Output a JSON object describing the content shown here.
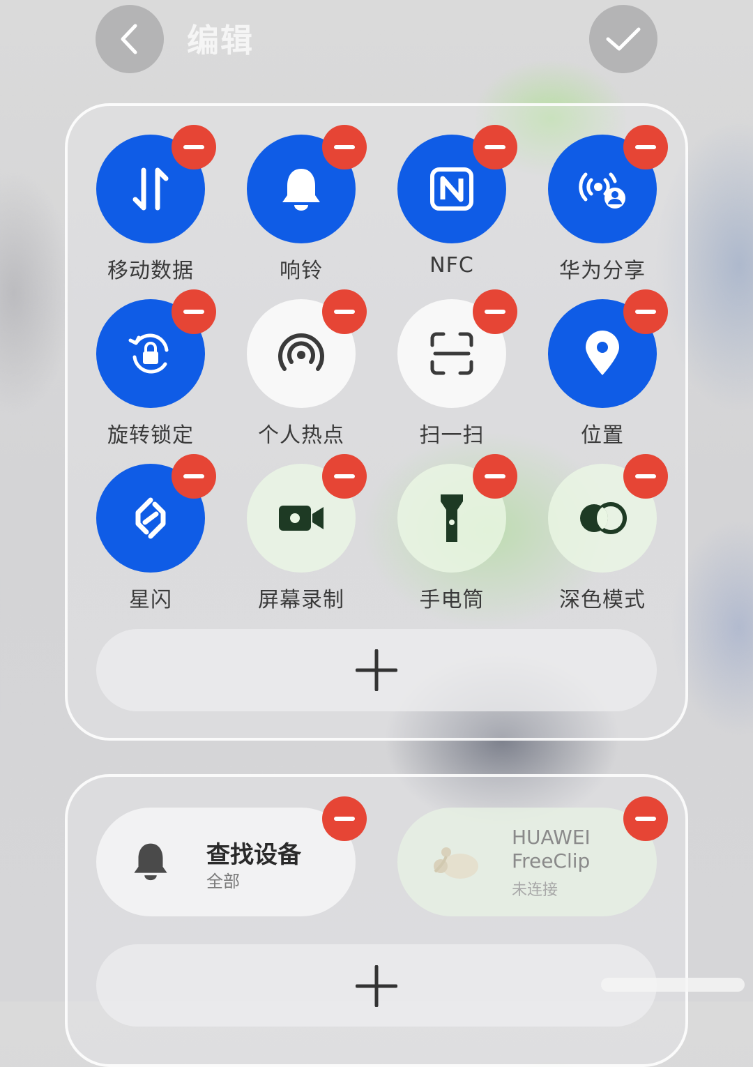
{
  "header": {
    "title": "编辑"
  },
  "tiles": [
    {
      "label": "移动数据",
      "icon": "mobile-data-icon",
      "state": "active"
    },
    {
      "label": "响铃",
      "icon": "bell-icon",
      "state": "active"
    },
    {
      "label": "NFC",
      "icon": "nfc-icon",
      "state": "active"
    },
    {
      "label": "华为分享",
      "icon": "huawei-share-icon",
      "state": "active"
    },
    {
      "label": "旋转锁定",
      "icon": "rotation-lock-icon",
      "state": "active"
    },
    {
      "label": "个人热点",
      "icon": "hotspot-icon",
      "state": "inactive"
    },
    {
      "label": "扫一扫",
      "icon": "scan-icon",
      "state": "inactive"
    },
    {
      "label": "位置",
      "icon": "location-icon",
      "state": "active"
    },
    {
      "label": "星闪",
      "icon": "nearlink-icon",
      "state": "active"
    },
    {
      "label": "屏幕录制",
      "icon": "screen-record-icon",
      "state": "inactive"
    },
    {
      "label": "手电筒",
      "icon": "flashlight-icon",
      "state": "inactive"
    },
    {
      "label": "深色模式",
      "icon": "dark-mode-icon",
      "state": "inactive"
    }
  ],
  "cards": {
    "find_device": {
      "title": "查找设备",
      "subtitle": "全部",
      "icon": "bell-icon"
    },
    "freeclip": {
      "title_line1": "HUAWEI",
      "title_line2": "FreeClip",
      "subtitle": "未连接",
      "icon": "earbuds-icon"
    }
  },
  "colors": {
    "accent": "#0f5ce6",
    "remove": "#e64535"
  }
}
